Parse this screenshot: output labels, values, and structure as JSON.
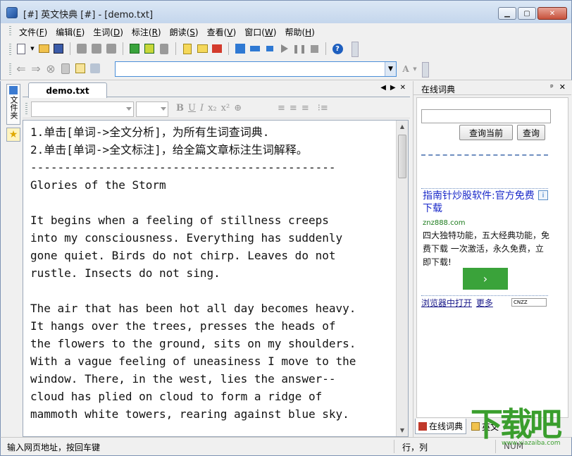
{
  "window": {
    "title": "[#] 英文快典 [#] - [demo.txt]",
    "buttons": {
      "minimize": "▁",
      "maximize": "▢",
      "close": "✕"
    }
  },
  "menu": {
    "items": [
      {
        "label": "文件(",
        "key": "F",
        "end": ")"
      },
      {
        "label": "编辑(",
        "key": "E",
        "end": ")"
      },
      {
        "label": "生词(",
        "key": "D",
        "end": ")"
      },
      {
        "label": "标注(",
        "key": "R",
        "end": ")"
      },
      {
        "label": "朗读(",
        "key": "S",
        "end": ")"
      },
      {
        "label": "查看(",
        "key": "V",
        "end": ")"
      },
      {
        "label": "窗口(",
        "key": "W",
        "end": ")"
      },
      {
        "label": "帮助(",
        "key": "H",
        "end": ")"
      }
    ]
  },
  "toolbar": {
    "icons": [
      "new-document-icon",
      "open-folder-icon",
      "save-icon",
      "cut-icon",
      "copy-icon",
      "paste-icon",
      "analyze-icon",
      "mark-icon",
      "page-icon",
      "word-list-icon",
      "highlight-icon",
      "clear-mark-icon",
      "read-icon",
      "read-line-icon",
      "read-word-icon",
      "play-icon",
      "pause-icon",
      "stop-icon",
      "help-icon"
    ],
    "help_glyph": "?"
  },
  "address_bar": {
    "value": "",
    "back": "⇐",
    "forward": "⇒",
    "stop": "⊗",
    "dropdown": "▼",
    "font_icon": "A"
  },
  "left_sidebar": {
    "tab_label": "文件夹",
    "star": "★"
  },
  "document": {
    "tab_label": "demo.txt",
    "ctrl_prev": "◀",
    "ctrl_next": "▶",
    "ctrl_close": "✕",
    "format_buttons": [
      "B",
      "U",
      "I",
      "x₂",
      "x²",
      "⊕"
    ],
    "text": "1.单击[单词->全文分析]，为所有生词查词典.\n2.单击[单词->全文标注]，给全篇文章标注生词解释。\n---------------------------------------------\nGlories of the Storm\n\nIt begins when a feeling of stillness creeps\ninto my consciousness. Everything has suddenly\ngone quiet. Birds do not chirp. Leaves do not\nrustle. Insects do not sing.\n\nThe air that has been hot all day becomes heavy.\nIt hangs over the trees, presses the heads of\nthe flowers to the ground, sits on my shoulders.\nWith a vague feeling of uneasiness I move to the\nwindow. There, in the west, lies the answer--\ncloud has plied on cloud to form a ridge of\nmammoth white towers, rearing against blue sky."
  },
  "online_dict": {
    "panel_title": "在线词典",
    "pin": "ᵖ",
    "close": "✕",
    "search_value": "",
    "query_current_button": "查询当前",
    "query_button": "查询",
    "ad": {
      "title": "指南针炒股软件:官方免费下载",
      "info": "i",
      "url": "znz888.com",
      "desc": "四大独特功能，五大经典功能，免费下载 一次激活，永久免费，立即下载!",
      "go": "›"
    },
    "link_open_browser": "浏览器中打开",
    "link_more": "更多",
    "cnzz": "CNZZ",
    "tabs": [
      {
        "label": "在线词典"
      },
      {
        "label": "英文"
      }
    ]
  },
  "status": {
    "hint": "输入网页地址，按回车键",
    "position": "行，列",
    "num": "NUM"
  },
  "watermark": {
    "main": "下载吧",
    "url": "www.xiazaiba.com"
  }
}
